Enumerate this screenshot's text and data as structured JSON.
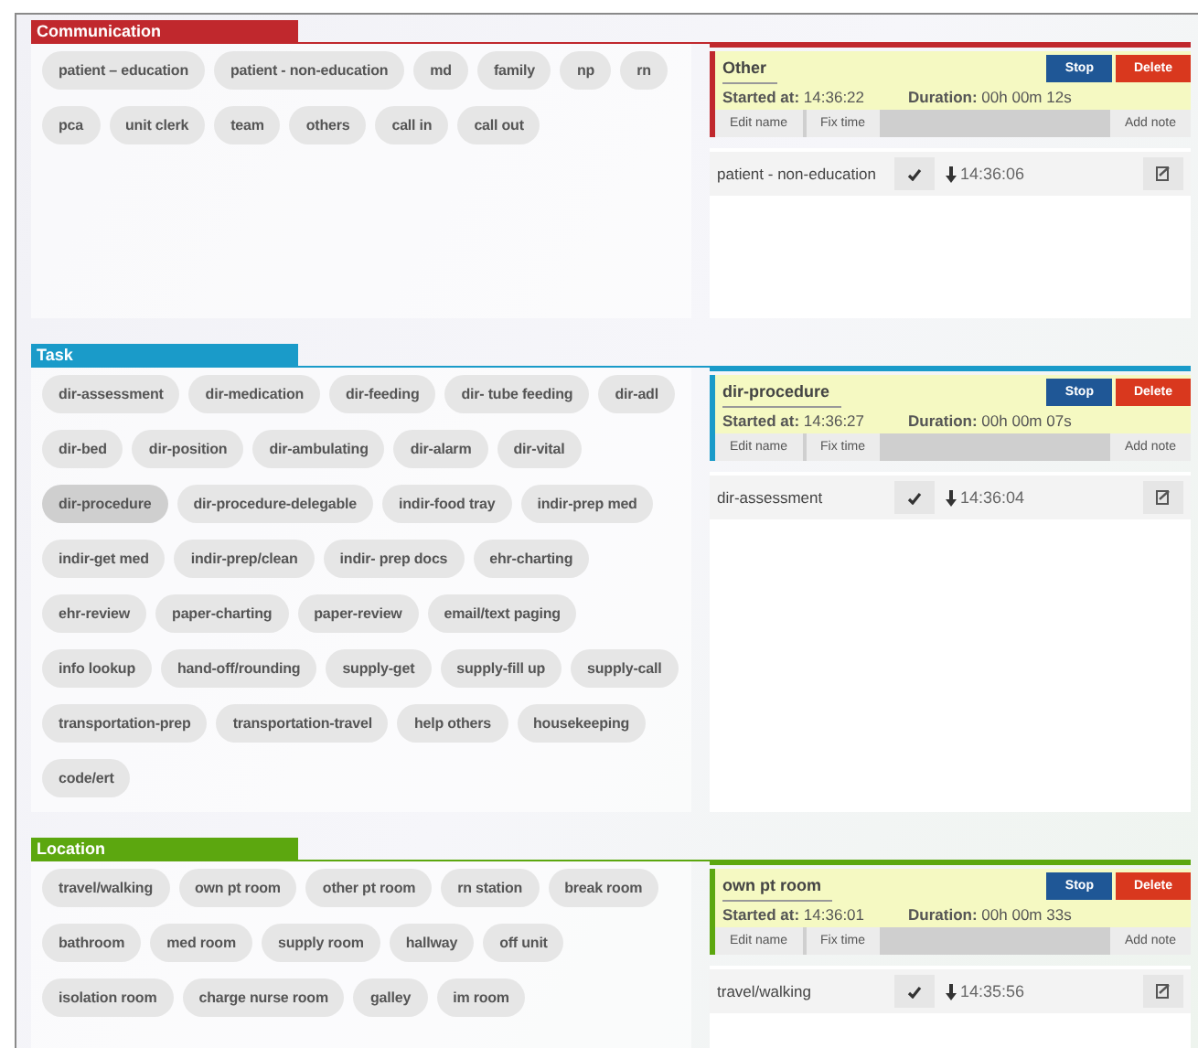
{
  "sections": [
    {
      "title": "Communication",
      "color": "#c0282d",
      "chips": [
        {
          "label": "patient – education",
          "selected": false
        },
        {
          "label": "patient - non-education",
          "selected": false
        },
        {
          "label": "md",
          "selected": false
        },
        {
          "label": "family",
          "selected": false
        },
        {
          "label": "np",
          "selected": false
        },
        {
          "label": "rn",
          "selected": false
        },
        {
          "label": "pca",
          "selected": false
        },
        {
          "label": "unit clerk",
          "selected": false
        },
        {
          "label": "team",
          "selected": false
        },
        {
          "label": "others",
          "selected": false
        },
        {
          "label": "call in",
          "selected": false
        },
        {
          "label": "call out",
          "selected": false
        }
      ],
      "current": {
        "name": "Other",
        "started_label": "Started at:",
        "started_time": "14:36:22",
        "duration_label": "Duration:",
        "duration": "00h 00m 12s",
        "stop": "Stop",
        "delete": "Delete",
        "edit_name": "Edit name",
        "fix_time": "Fix time",
        "add_note": "Add note"
      },
      "log": [
        {
          "name": "patient - non-education",
          "time": "14:36:06"
        }
      ]
    },
    {
      "title": "Task",
      "color": "#1a9bc9",
      "chips": [
        {
          "label": "dir-assessment",
          "selected": false
        },
        {
          "label": "dir-medication",
          "selected": false
        },
        {
          "label": "dir-feeding",
          "selected": false
        },
        {
          "label": "dir- tube feeding",
          "selected": false
        },
        {
          "label": "dir-adl",
          "selected": false
        },
        {
          "label": "dir-bed",
          "selected": false
        },
        {
          "label": "dir-position",
          "selected": false
        },
        {
          "label": "dir-ambulating",
          "selected": false
        },
        {
          "label": "dir-alarm",
          "selected": false
        },
        {
          "label": "dir-vital",
          "selected": false
        },
        {
          "label": "dir-procedure",
          "selected": true
        },
        {
          "label": "dir-procedure-delegable",
          "selected": false
        },
        {
          "label": "indir-food tray",
          "selected": false
        },
        {
          "label": "indir-prep med",
          "selected": false
        },
        {
          "label": "indir-get med",
          "selected": false
        },
        {
          "label": "indir-prep/clean",
          "selected": false
        },
        {
          "label": "indir- prep docs",
          "selected": false
        },
        {
          "label": "ehr-charting",
          "selected": false
        },
        {
          "label": "ehr-review",
          "selected": false
        },
        {
          "label": "paper-charting",
          "selected": false
        },
        {
          "label": "paper-review",
          "selected": false
        },
        {
          "label": "email/text paging",
          "selected": false
        },
        {
          "label": "info lookup",
          "selected": false
        },
        {
          "label": "hand-off/rounding",
          "selected": false
        },
        {
          "label": "supply-get",
          "selected": false
        },
        {
          "label": "supply-fill up",
          "selected": false
        },
        {
          "label": "supply-call",
          "selected": false
        },
        {
          "label": "transportation-prep",
          "selected": false
        },
        {
          "label": "transportation-travel",
          "selected": false
        },
        {
          "label": "help others",
          "selected": false
        },
        {
          "label": "housekeeping",
          "selected": false
        },
        {
          "label": "code/ert",
          "selected": false
        }
      ],
      "current": {
        "name": "dir-procedure",
        "started_label": "Started at:",
        "started_time": "14:36:27",
        "duration_label": "Duration:",
        "duration": "00h 00m 07s",
        "stop": "Stop",
        "delete": "Delete",
        "edit_name": "Edit name",
        "fix_time": "Fix time",
        "add_note": "Add note"
      },
      "log": [
        {
          "name": "dir-assessment",
          "time": "14:36:04"
        }
      ]
    },
    {
      "title": "Location",
      "color": "#5ca70f",
      "chips": [
        {
          "label": "travel/walking",
          "selected": false
        },
        {
          "label": "own pt room",
          "selected": false
        },
        {
          "label": "other pt room",
          "selected": false
        },
        {
          "label": "rn station",
          "selected": false
        },
        {
          "label": "break room",
          "selected": false
        },
        {
          "label": "bathroom",
          "selected": false
        },
        {
          "label": "med room",
          "selected": false
        },
        {
          "label": "supply room",
          "selected": false
        },
        {
          "label": "hallway",
          "selected": false
        },
        {
          "label": "off unit",
          "selected": false
        },
        {
          "label": "isolation room",
          "selected": false
        },
        {
          "label": "charge nurse room",
          "selected": false
        },
        {
          "label": "galley",
          "selected": false
        },
        {
          "label": "im room",
          "selected": false
        }
      ],
      "current": {
        "name": "own pt room",
        "started_label": "Started at:",
        "started_time": "14:36:01",
        "duration_label": "Duration:",
        "duration": "00h 00m 33s",
        "stop": "Stop",
        "delete": "Delete",
        "edit_name": "Edit name",
        "fix_time": "Fix time",
        "add_note": "Add note"
      },
      "log": [
        {
          "name": "travel/walking",
          "time": "14:35:56"
        }
      ]
    }
  ]
}
